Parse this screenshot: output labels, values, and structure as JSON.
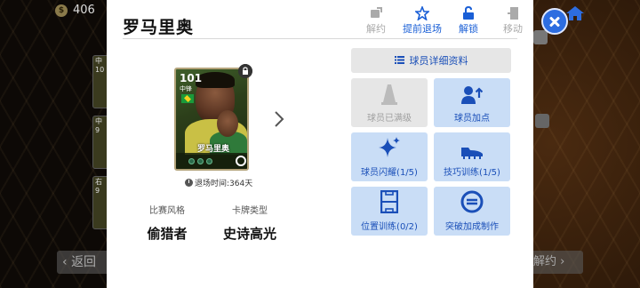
{
  "background": {
    "coin_value": "406",
    "coin_symbol": "$",
    "back_label": "返回",
    "right_button_label": "解约",
    "side_cards": [
      {
        "rating": "中",
        "sub": "10"
      },
      {
        "rating": "中",
        "sub": "9"
      },
      {
        "rating": "右",
        "sub": "9"
      }
    ]
  },
  "modal": {
    "player_name": "罗马里奥",
    "actions": [
      {
        "label": "解约",
        "state": "disabled",
        "icon": "release-icon"
      },
      {
        "label": "提前退场",
        "state": "active",
        "icon": "star-exit-icon"
      },
      {
        "label": "解锁",
        "state": "active",
        "icon": "unlock-icon"
      },
      {
        "label": "移动",
        "state": "disabled",
        "icon": "move-icon"
      }
    ],
    "card": {
      "rating": "101",
      "position": "中锋",
      "name": "罗马里奥",
      "retire_text": "退场时间:364天"
    },
    "meta": {
      "style_label": "比赛风格",
      "style_value": "偷猎者",
      "card_type_label": "卡牌类型",
      "card_type_value": "史诗高光"
    },
    "detail_button": "球员详细资料",
    "tiles": [
      {
        "label": "球员已满级",
        "state": "off",
        "icon": "cone-icon"
      },
      {
        "label": "球员加点",
        "state": "on",
        "icon": "player-boost-icon"
      },
      {
        "label": "球员闪耀(1/5)",
        "state": "on",
        "icon": "sparkle-icon"
      },
      {
        "label": "技巧训练(1/5)",
        "state": "on",
        "icon": "boot-icon"
      },
      {
        "label": "位置训练(0/2)",
        "state": "on",
        "icon": "pitch-icon"
      },
      {
        "label": "突破加成制作",
        "state": "on",
        "icon": "efootball-icon"
      }
    ]
  },
  "colors": {
    "accent_blue": "#1a4fb8",
    "tile_on": "#c9ddf6",
    "tile_off": "#e6e6e6",
    "close_blue": "#2d6de0"
  }
}
